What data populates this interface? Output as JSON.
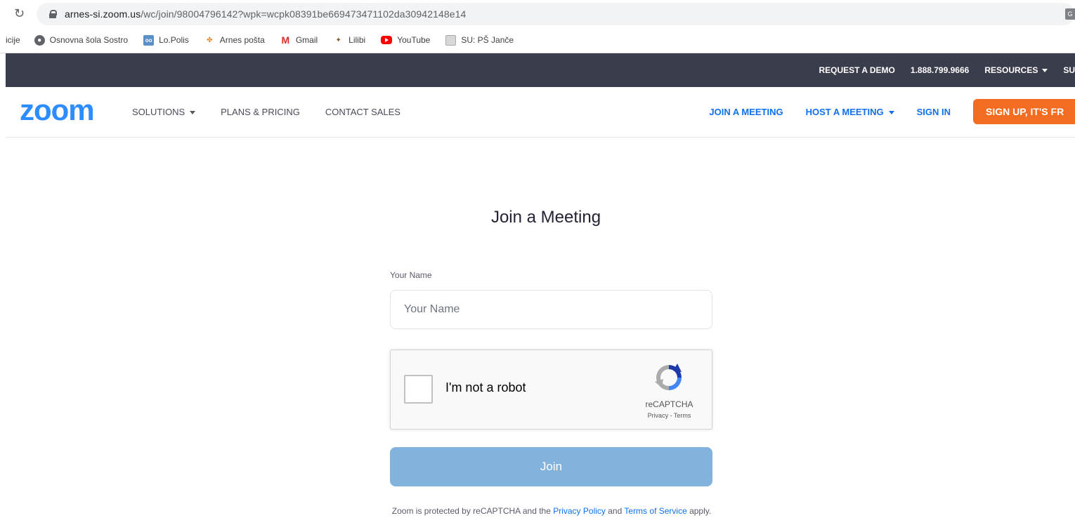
{
  "browser": {
    "url_host": "arnes-si.zoom.us",
    "url_path": "/wc/join/98004796142?wpk=wcpk08391be669473471102da30942148e14",
    "bookmarks": [
      {
        "label": "icije",
        "icon": "none"
      },
      {
        "label": "Osnovna šola Sostro",
        "icon": "globe-icon"
      },
      {
        "label": "Lo.Polis",
        "icon": "lopolis-icon"
      },
      {
        "label": "Arnes pošta",
        "icon": "arnes-icon"
      },
      {
        "label": "Gmail",
        "icon": "gmail-icon"
      },
      {
        "label": "Lilibi",
        "icon": "lilibi-icon"
      },
      {
        "label": "YouTube",
        "icon": "youtube-icon"
      },
      {
        "label": "SU: PŠ Janče",
        "icon": "su-icon"
      }
    ]
  },
  "topbar": {
    "request_demo": "REQUEST A DEMO",
    "phone": "1.888.799.9666",
    "resources": "RESOURCES",
    "support": "SU"
  },
  "nav": {
    "logo": "zoom",
    "solutions": "SOLUTIONS",
    "plans": "PLANS & PRICING",
    "contact": "CONTACT SALES",
    "join_meeting": "JOIN A MEETING",
    "host_meeting": "HOST A MEETING",
    "sign_in": "SIGN IN",
    "sign_up": "SIGN UP, IT'S FR"
  },
  "form": {
    "title": "Join a Meeting",
    "name_label": "Your Name",
    "name_placeholder": "Your Name",
    "name_value": "",
    "captcha_label": "I'm not a robot",
    "captcha_brand": "reCAPTCHA",
    "captcha_privacy": "Privacy",
    "captcha_sep": " - ",
    "captcha_terms": "Terms",
    "join_label": "Join"
  },
  "footer": {
    "prefix": "Zoom is protected by reCAPTCHA and the ",
    "privacy": "Privacy Policy",
    "mid": " and ",
    "terms": "Terms of Service",
    "suffix": " apply."
  },
  "colors": {
    "zoom_blue": "#2d8cff",
    "link_blue": "#0e71eb",
    "topbar_bg": "#3a3d4b",
    "signup_orange": "#f26d21",
    "join_disabled": "#82b3dd"
  }
}
